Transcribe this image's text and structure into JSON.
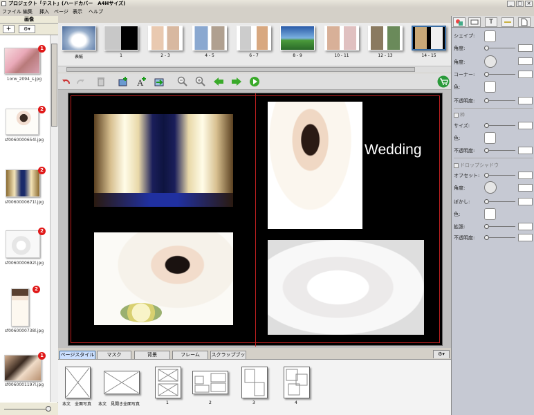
{
  "window": {
    "title": "プロジェクト「テスト」(ハードカバー　A4Hサイズ)"
  },
  "menu": [
    "ファイル",
    "編集",
    "挿入",
    "ページ",
    "表示",
    "ヘルプ"
  ],
  "left_panel": {
    "header": "画像",
    "add_label": "+",
    "gear_label": "⚙▾",
    "images": [
      {
        "file": "1orw_2094_s.jpg",
        "count": "1"
      },
      {
        "file": "sf0060000654l.jpg",
        "count": "2"
      },
      {
        "file": "sf0060000671l.jpg",
        "count": "2"
      },
      {
        "file": "sf0060000692l.jpg",
        "count": "2"
      },
      {
        "file": "sf0060000738l.jpg",
        "count": "2"
      },
      {
        "file": "sf0060001197l.jpg",
        "count": "1"
      }
    ]
  },
  "page_strip": [
    "表紙",
    "1",
    "2 - 3",
    "4 - 5",
    "6 - 7",
    "8 - 9",
    "10 - 11",
    "12 - 13",
    "14 - 15"
  ],
  "canvas": {
    "text": "Wedding"
  },
  "bottom_tabs": [
    "ページスタイル",
    "マスク",
    "背景",
    "フレーム",
    "スクラップブック"
  ],
  "layouts": [
    "本文　全面写真",
    "本文　見開き全面写真",
    "1",
    "2",
    "3",
    "4"
  ],
  "properties": {
    "shape": "シェイプ:",
    "rotation": "角度:",
    "angle": "角度:",
    "corner": "コーナー:",
    "color": "色:",
    "opacity": "不透明度:",
    "frame_check": "枠",
    "size": "サイズ:",
    "frame_color": "色:",
    "frame_opacity": "不透明度:",
    "shadow_check": "ドロップシャドウ",
    "offset": "オフセット:",
    "shadow_angle": "角度:",
    "blur": "ぼかし:",
    "shadow_color": "色:",
    "spread": "拡張:",
    "shadow_opacity": "不透明度:"
  }
}
